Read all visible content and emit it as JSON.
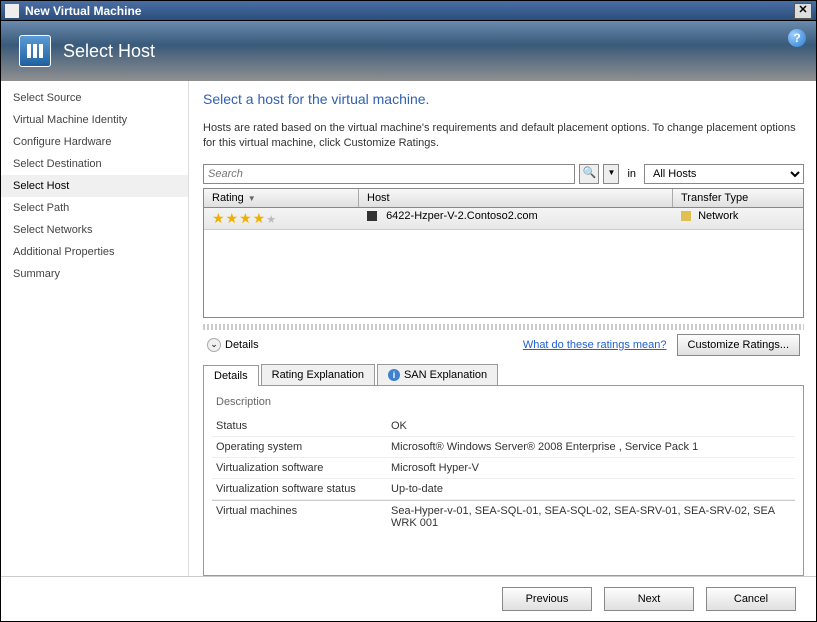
{
  "window": {
    "title": "New Virtual Machine"
  },
  "header": {
    "title": "Select Host"
  },
  "sidebar": {
    "items": [
      {
        "label": "Select Source"
      },
      {
        "label": "Virtual Machine Identity"
      },
      {
        "label": "Configure Hardware"
      },
      {
        "label": "Select Destination"
      },
      {
        "label": "Select Host",
        "selected": true
      },
      {
        "label": "Select Path"
      },
      {
        "label": "Select Networks"
      },
      {
        "label": "Additional Properties"
      },
      {
        "label": "Summary"
      }
    ]
  },
  "main": {
    "title": "Select a host for the virtual machine.",
    "desc": "Hosts are rated based on the virtual machine's requirements and default placement options. To change placement options for this virtual machine, click Customize Ratings.",
    "search_placeholder": "Search",
    "in_label": "in",
    "hosts_filter": "All Hosts",
    "columns": {
      "rating": "Rating",
      "host": "Host",
      "transfer": "Transfer Type"
    },
    "hosts": [
      {
        "rating": 4,
        "host": "6422-Hzper-V-2.Contoso2.com",
        "transfer": "Network"
      }
    ],
    "details_label": "Details",
    "ratings_link": "What do these ratings mean?",
    "customize_btn": "Customize Ratings...",
    "tabs": [
      {
        "label": "Details"
      },
      {
        "label": "Rating Explanation"
      },
      {
        "label": "SAN Explanation"
      }
    ],
    "description_label": "Description",
    "properties": [
      {
        "label": "Status",
        "value": "OK"
      },
      {
        "label": "Operating system",
        "value": "Microsoft® Windows Server® 2008 Enterprise , Service Pack 1"
      },
      {
        "label": "Virtualization software",
        "value": "Microsoft Hyper-V"
      },
      {
        "label": "Virtualization software status",
        "value": "Up-to-date"
      },
      {
        "label": "Virtual machines",
        "value": "Sea-Hyper-v-01, SEA-SQL-01, SEA-SQL-02, SEA-SRV-01, SEA-SRV-02, SEA WRK 001"
      }
    ]
  },
  "footer": {
    "previous": "Previous",
    "next": "Next",
    "cancel": "Cancel"
  }
}
